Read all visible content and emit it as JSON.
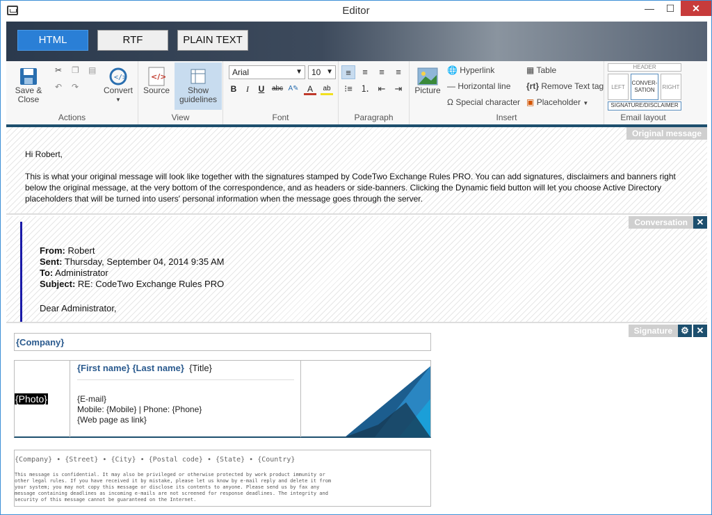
{
  "window": {
    "title": "Editor",
    "min": "—",
    "max": "☐",
    "close": "✕"
  },
  "modes": [
    {
      "label": "HTML",
      "active": true
    },
    {
      "label": "RTF",
      "active": false
    },
    {
      "label": "PLAIN TEXT",
      "active": false
    }
  ],
  "ribbon": {
    "actions": {
      "save_close": "Save &\nClose",
      "convert": "Convert",
      "label": "Actions"
    },
    "view": {
      "source": "Source",
      "show_guidelines": "Show\nguidelines",
      "label": "View"
    },
    "font": {
      "family": "Arial",
      "size": "10",
      "label": "Font",
      "bold": "B",
      "italic": "I",
      "underline": "U",
      "strike": "abc"
    },
    "paragraph": {
      "label": "Paragraph"
    },
    "insert": {
      "picture": "Picture",
      "hyperlink": "Hyperlink",
      "horizontal_line": "Horizontal line",
      "special_character": "Special character",
      "table": "Table",
      "remove_text_tag": "Remove Text tag",
      "placeholder": "Placeholder",
      "rt_icon": "{rt}",
      "label": "Insert"
    },
    "email_layout": {
      "header": "HEADER",
      "left": "LEFT",
      "conversation": "CONVER-\nSATION",
      "right": "RIGHT",
      "signature": "SIGNATURE/DISCLAIMER",
      "label": "Email layout"
    }
  },
  "original": {
    "tag": "Original message",
    "greeting": "Hi Robert,",
    "body": "This is what your original message will look like together with the signatures stamped by CodeTwo Exchange Rules PRO. You can add signatures, disclaimers and banners right below the original message, at the very bottom of the correspondence, and as headers or side-banners. Clicking the Dynamic field button will let you choose Active Directory placeholders that will be turned into users' personal information when the message goes through the server."
  },
  "conversation": {
    "tag": "Conversation",
    "from_label": "From:",
    "from": "Robert",
    "sent_label": "Sent:",
    "sent": "Thursday, September 04, 2014 9:35 AM",
    "to_label": "To:",
    "to": "Administrator",
    "subject_label": "Subject:",
    "subject": "RE: CodeTwo Exchange Rules PRO",
    "greeting": "Dear Administrator,"
  },
  "signature": {
    "tag": "Signature",
    "company": "{Company}",
    "photo": "{Photo}",
    "name": "{First name} {Last name}",
    "title": "{Title}",
    "email": "{E-mail}",
    "phones": "Mobile:  {Mobile} | Phone: {Phone}",
    "web": "{Web page as link}",
    "address": "{Company} • {Street} • {City}  • {Postal code} • {State} • {Country}",
    "disclaimer": "This message is confidential. It may also be privileged or otherwise protected by work product immunity or other legal rules. If you have received it by mistake, please let us know by e-mail reply and delete it from your system; you may not copy this message or disclose its contents to anyone. Please send us by fax any message containing deadlines as incoming e-mails are not screened for response deadlines. The integrity and security of this message cannot be guaranteed on the Internet."
  }
}
